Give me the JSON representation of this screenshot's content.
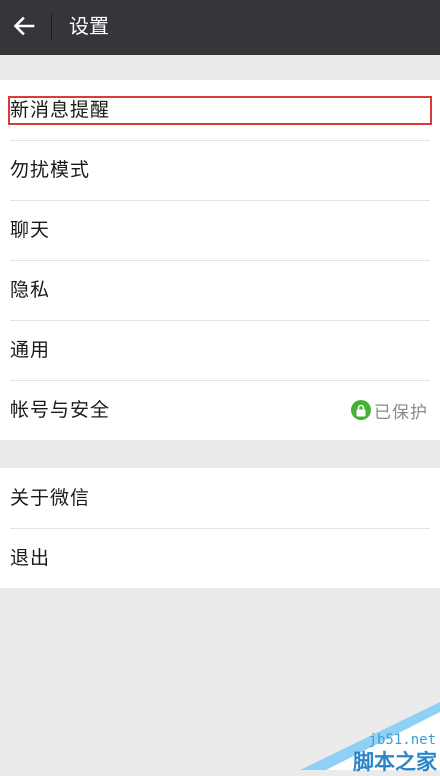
{
  "header": {
    "title": "设置",
    "back_icon": "arrow-left-icon"
  },
  "groups": [
    {
      "items": [
        {
          "label": "新消息提醒",
          "highlighted": true
        },
        {
          "label": "勿扰模式"
        },
        {
          "label": "聊天"
        },
        {
          "label": "隐私"
        },
        {
          "label": "通用"
        },
        {
          "label": "帐号与安全",
          "status": "已保护",
          "status_icon": "lock-icon"
        }
      ]
    },
    {
      "items": [
        {
          "label": "关于微信"
        },
        {
          "label": "退出"
        }
      ]
    }
  ],
  "watermark": {
    "url": "jb51.net",
    "name": "脚本之家"
  },
  "colors": {
    "topbar": "#35353a",
    "background": "#ebebeb",
    "highlight_border": "#d93a3a",
    "lock_badge": "#45b035"
  }
}
